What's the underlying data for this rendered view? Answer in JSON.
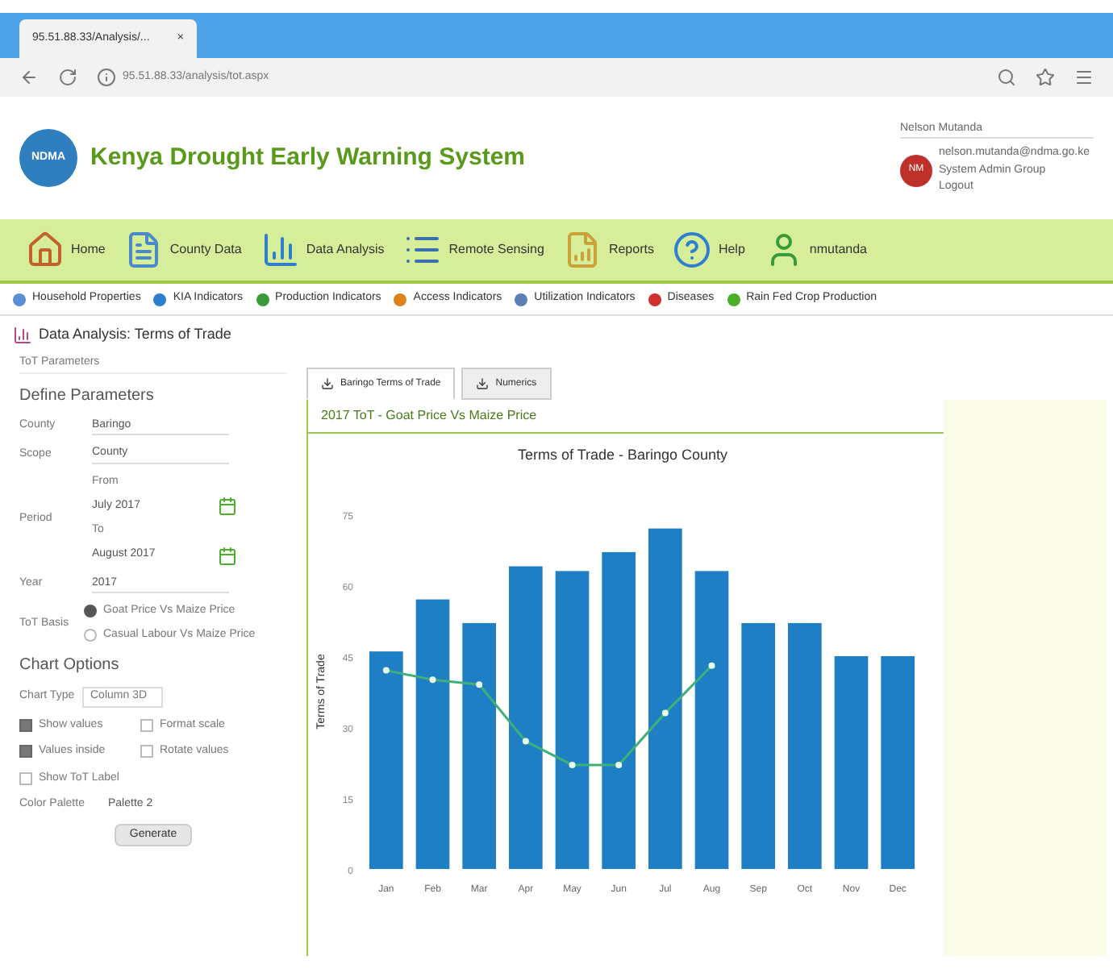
{
  "browser": {
    "tab_title": "95.51.88.33/Analysis/...",
    "close_glyph": "×",
    "address": "95.51.88.33/analysis/tot.aspx"
  },
  "header": {
    "title": "Kenya Drought Early Warning System",
    "logo_text": "NDMA",
    "user": {
      "name": "Nelson Mutanda",
      "email": "nelson.mutanda@ndma.go.ke",
      "group": "System Admin Group",
      "logout": "Logout",
      "initials": "NM"
    }
  },
  "nav": [
    {
      "label": "Home",
      "kind": "home"
    },
    {
      "label": "County Data",
      "kind": "doc"
    },
    {
      "label": "Data Analysis",
      "kind": "chart"
    },
    {
      "label": "Remote Sensing",
      "kind": "list"
    },
    {
      "label": "Reports",
      "kind": "report"
    },
    {
      "label": "Help",
      "kind": "help"
    },
    {
      "label": "nmutanda",
      "kind": "user"
    }
  ],
  "subnav": [
    {
      "label": "Household Properties",
      "color": "#5b8fd6"
    },
    {
      "label": "KIA Indicators",
      "color": "#2f7fd0"
    },
    {
      "label": "Production Indicators",
      "color": "#3a9a3a"
    },
    {
      "label": "Access Indicators",
      "color": "#d9851e"
    },
    {
      "label": "Utilization Indicators",
      "color": "#5b7fb6"
    },
    {
      "label": "Diseases",
      "color": "#d03030"
    },
    {
      "label": "Rain Fed Crop Production",
      "color": "#4caf2a"
    }
  ],
  "page_title": "Data Analysis: Terms of Trade",
  "params": {
    "legend": "ToT Parameters",
    "heading": "Define Parameters",
    "fields": [
      {
        "kind": "select",
        "label": "County",
        "value": "Baringo"
      },
      {
        "kind": "select",
        "label": "Scope",
        "value": "County"
      },
      {
        "kind": "period",
        "label": "Period",
        "from_label": "From",
        "from": "July 2017",
        "to_label": "To",
        "to": "August 2017"
      },
      {
        "kind": "select",
        "label": "Year",
        "value": "2017"
      }
    ],
    "basis": {
      "label": "ToT Basis",
      "options": [
        {
          "label": "Goat Price Vs Maize Price",
          "selected": true
        },
        {
          "label": "Casual Labour Vs Maize Price",
          "selected": false
        }
      ]
    },
    "chart_heading": "Chart Options",
    "chart_type": {
      "label": "Chart Type",
      "value": "Column 3D"
    },
    "checks": [
      {
        "label": "Show values",
        "checked": true
      },
      {
        "label": "Format scale",
        "checked": false
      },
      {
        "label": "Values inside",
        "checked": true
      },
      {
        "label": "Rotate values",
        "checked": false
      },
      {
        "label": "Show ToT Label",
        "checked": false
      }
    ],
    "palette": {
      "label": "Color Palette",
      "value": "Palette 2"
    },
    "generate": "Generate"
  },
  "tabs": [
    {
      "label": "Baringo Terms of Trade",
      "selected": true
    },
    {
      "label": "Numerics",
      "selected": false
    }
  ],
  "panel_title": "2017 ToT - Goat Price Vs Maize Price",
  "chart_data": {
    "type": "bar",
    "title": "Terms of Trade - Baringo County",
    "ylabel": "Terms of Trade",
    "categories": [
      "Jan",
      "Feb",
      "Mar",
      "Apr",
      "May",
      "Jun",
      "Jul",
      "Aug",
      "Sep",
      "Oct",
      "Nov",
      "Dec"
    ],
    "series": [
      {
        "type": "bar",
        "color": "#1f7fc4",
        "values": [
          46,
          57,
          52,
          64,
          63,
          67,
          72,
          63,
          52,
          52,
          45,
          45
        ]
      },
      {
        "type": "line",
        "marker": "circle",
        "color": "#3fb07a",
        "values": [
          42,
          40,
          39,
          27,
          22,
          22,
          33,
          43,
          null,
          null,
          null,
          null
        ]
      }
    ],
    "ylim": [
      0,
      75
    ],
    "yticks": [
      0,
      15,
      30,
      45,
      60,
      75
    ]
  }
}
